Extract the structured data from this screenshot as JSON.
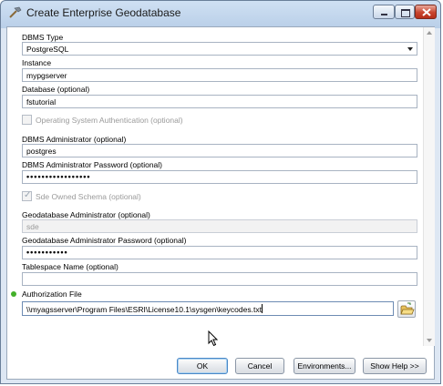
{
  "window": {
    "title": "Create Enterprise Geodatabase",
    "controls": [
      "minimize",
      "maximize",
      "close"
    ]
  },
  "form": {
    "dbms_type": {
      "label": "DBMS Type",
      "value": "PostgreSQL"
    },
    "instance": {
      "label": "Instance",
      "value": "mypgserver"
    },
    "database": {
      "label": "Database (optional)",
      "value": "fstutorial"
    },
    "os_auth": {
      "label": "Operating System Authentication (optional)",
      "checked": false,
      "enabled": false
    },
    "dbms_admin": {
      "label": "DBMS Administrator (optional)",
      "value": "postgres"
    },
    "dbms_admin_password": {
      "label": "DBMS Administrator Password (optional)",
      "value": "•••••••••••••••••"
    },
    "sde_owned_schema": {
      "label": "Sde Owned Schema (optional)",
      "checked": true,
      "enabled": false
    },
    "gdb_admin": {
      "label": "Geodatabase Administrator (optional)",
      "value": "sde"
    },
    "gdb_admin_password": {
      "label": "Geodatabase Administrator Password (optional)",
      "value": "•••••••••••"
    },
    "tablespace": {
      "label": "Tablespace Name (optional)",
      "value": ""
    },
    "authorization_file": {
      "label": "Authorization File",
      "value": "\\\\myagsserver\\Program Files\\ESRI\\License10.1\\sysgen\\keycodes.txt",
      "required": true
    }
  },
  "buttons": {
    "ok": "OK",
    "cancel": "Cancel",
    "environments": "Environments...",
    "show_help": "Show Help >>"
  },
  "colors": {
    "required_indicator": "#43b02a",
    "ok_focus": "#4a88c7"
  },
  "icons": {
    "title": "hammer-icon",
    "browse": "open-folder-icon"
  }
}
